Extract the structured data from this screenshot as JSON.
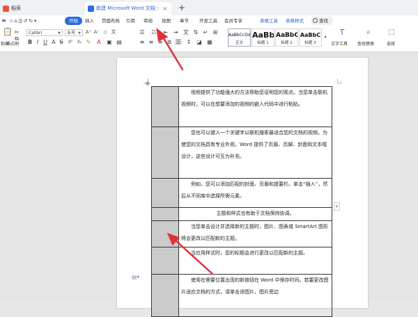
{
  "tabs": [
    {
      "label": "稻壳",
      "active": false
    },
    {
      "label": "新建 Microsoft Word 文档",
      "active": true
    }
  ],
  "new_tab_label": "+",
  "menu": {
    "items": [
      "开始",
      "插入",
      "页面布局",
      "引用",
      "审阅",
      "视图",
      "章节",
      "开发工具",
      "会员专享"
    ],
    "active_index": 0,
    "context_tabs": [
      "表格工具",
      "表格样式"
    ],
    "search_label": "查找"
  },
  "ribbon": {
    "paste_label": "粘贴",
    "format_painter_label": "格式刷",
    "font_name": "Calibri",
    "font_size": "五号",
    "style_gallery": [
      {
        "preview": "AaBbCcDd",
        "name": "正文",
        "selected": true
      },
      {
        "preview": "AaBb",
        "name": "标题 1",
        "selected": false
      },
      {
        "preview": "AaBbC",
        "name": "标题 2",
        "selected": false
      },
      {
        "preview": "AaBbC",
        "name": "标题 3",
        "selected": false
      }
    ],
    "text_tools_label": "文字工具",
    "find_replace_label": "查找替换",
    "select_label": "选择"
  },
  "document": {
    "rows": [
      {
        "text": "视频提供了功能强大的方法帮助您证明您的观点。当您单击联机视频时，可以在想要添加的视频的嵌入代码中进行粘贴。",
        "center": false
      },
      {
        "text": "您也可以键入一个关键字以联机搜索最适合您的文档的视频。为使您的文档具有专业外观，Word 提供了页眉、页脚、封面和文本框设计，这些设计可互为补充。",
        "center": false
      },
      {
        "text": "例如，您可以添加匹配的封面、页眉和提要栏。单击“插入”，然后从不同库中选择所需元素。",
        "center": false
      },
      {
        "text": "主题和样式也有助于文档保持协调。",
        "center": true
      },
      {
        "text": "当您单击设计并选择新的主题时，图片、图表或 SmartArt 图形将会更改以匹配新的主题。",
        "center": false
      },
      {
        "text": "当应用样式时，您的标题会进行更改以匹配新的主题。",
        "center": false
      },
      {
        "text": "使用在需要位置出现的新按钮在 Word 中保存时间。若要更改图片适应文档的方式，请单击该图片，图片旁边",
        "center": false
      }
    ]
  },
  "colors": {
    "accent": "#2d6be3",
    "arrow": "#e0313b",
    "cell_shade": "#cbcbcb"
  }
}
